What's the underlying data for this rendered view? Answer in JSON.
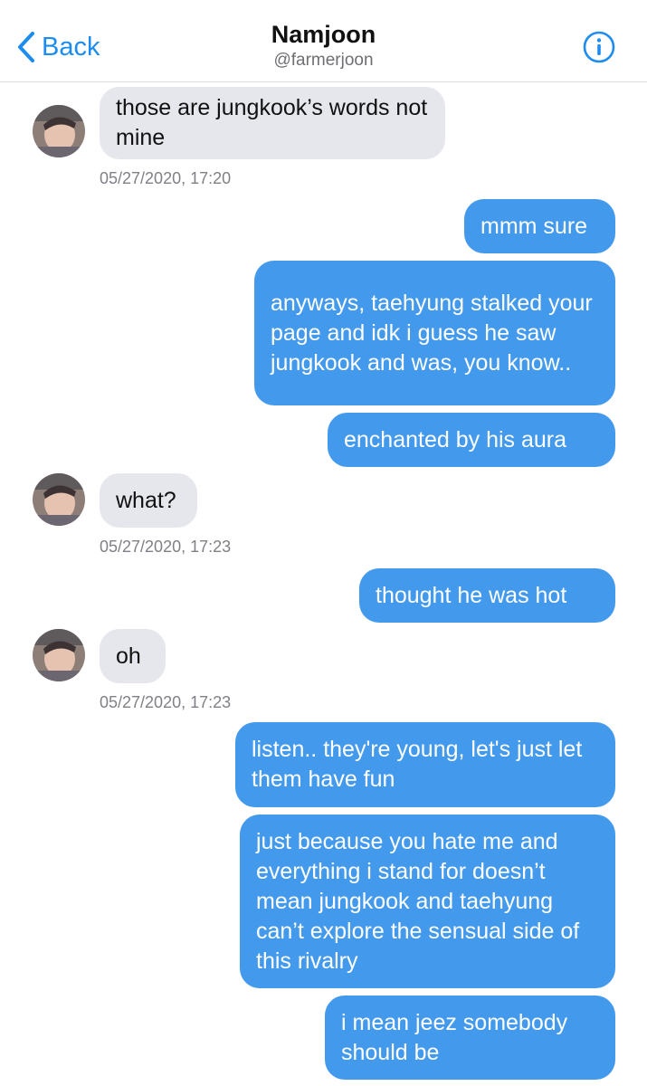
{
  "header": {
    "back_label": "Back",
    "title": "Namjoon",
    "handle": "@farmerjoon"
  },
  "colors": {
    "accent": "#1d8cf0",
    "outgoing_bubble": "#4399ec",
    "incoming_bubble": "#e6e7ec",
    "timestamp": "#808087"
  },
  "icons": {
    "back": "chevron-left-icon",
    "info": "info-icon",
    "avatar": "avatar-photo"
  },
  "messages": [
    {
      "from": "them",
      "text": "those are jungkook’s words not mine",
      "timestamp": "05/27/2020, 17:20"
    },
    {
      "from": "me",
      "text": "mmm sure"
    },
    {
      "from": "me",
      "text": "anyways, taehyung stalked your page and idk i guess he saw jungkook and was, you know.."
    },
    {
      "from": "me",
      "text": "enchanted by his aura"
    },
    {
      "from": "them",
      "text": "what?",
      "timestamp": "05/27/2020, 17:23"
    },
    {
      "from": "me",
      "text": "thought he was hot"
    },
    {
      "from": "them",
      "text": "oh",
      "timestamp": "05/27/2020, 17:23"
    },
    {
      "from": "me",
      "text": "listen.. they're young, let's just let them have fun"
    },
    {
      "from": "me",
      "text": "just because you hate me and everything i stand for doesn’t mean jungkook and taehyung can’t explore the sensual side of this rivalry"
    },
    {
      "from": "me",
      "text": "i mean jeez somebody should be"
    }
  ]
}
